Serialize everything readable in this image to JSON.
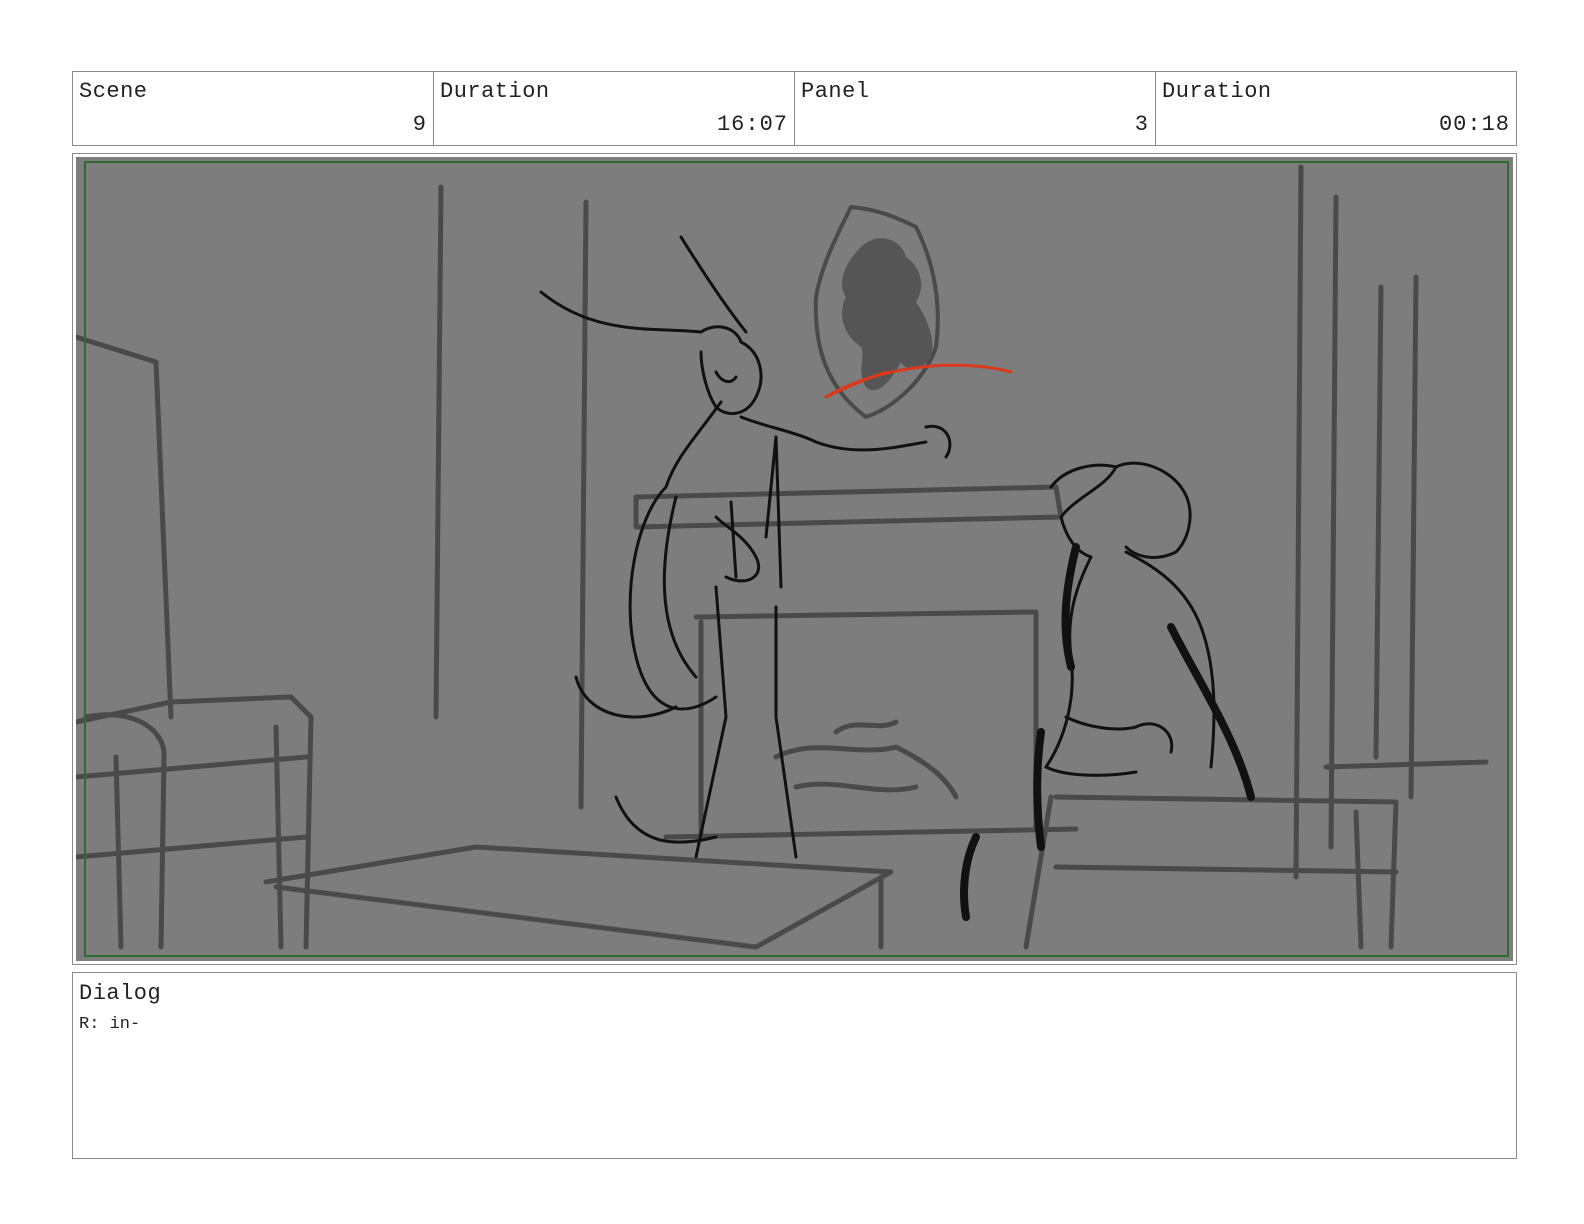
{
  "header": {
    "scene_label": "Scene",
    "scene_value": "9",
    "scene_duration_label": "Duration",
    "scene_duration_value": "16:07",
    "panel_label": "Panel",
    "panel_value": "3",
    "panel_duration_label": "Duration",
    "panel_duration_value": "00:18"
  },
  "panel_image": {
    "background_color": "#7d7d7d",
    "safe_area_color": "#2f6b2f",
    "ink_color": "#111111",
    "sketch_color": "#4a4a4a",
    "correction_color": "#d93a1e"
  },
  "dialog": {
    "label": "Dialog",
    "text": "R: in-"
  }
}
